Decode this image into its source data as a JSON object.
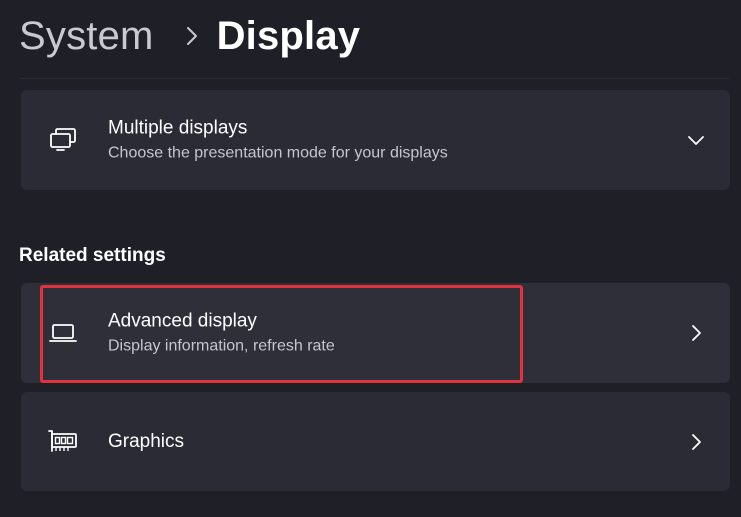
{
  "breadcrumb": {
    "parent": "System",
    "current": "Display",
    "separator_icon": "chevron-right-icon"
  },
  "multiple_displays": {
    "title": "Multiple displays",
    "subtitle": "Choose the presentation mode for your displays",
    "icon": "multiple-monitors-icon",
    "action_icon": "chevron-down-icon",
    "expanded": false
  },
  "related_settings": {
    "heading": "Related settings",
    "items": [
      {
        "title": "Advanced display",
        "subtitle": "Display information, refresh rate",
        "icon": "laptop-icon",
        "action_icon": "chevron-right-icon",
        "highlighted": true
      },
      {
        "title": "Graphics",
        "subtitle": "",
        "icon": "graphics-card-icon",
        "action_icon": "chevron-right-icon",
        "highlighted": false
      }
    ]
  },
  "colors": {
    "background": "#1f1f28",
    "card": "#2b2b35",
    "highlight_border": "#e0333d",
    "text_primary": "#ffffff",
    "text_secondary": "#c5c5cc"
  }
}
